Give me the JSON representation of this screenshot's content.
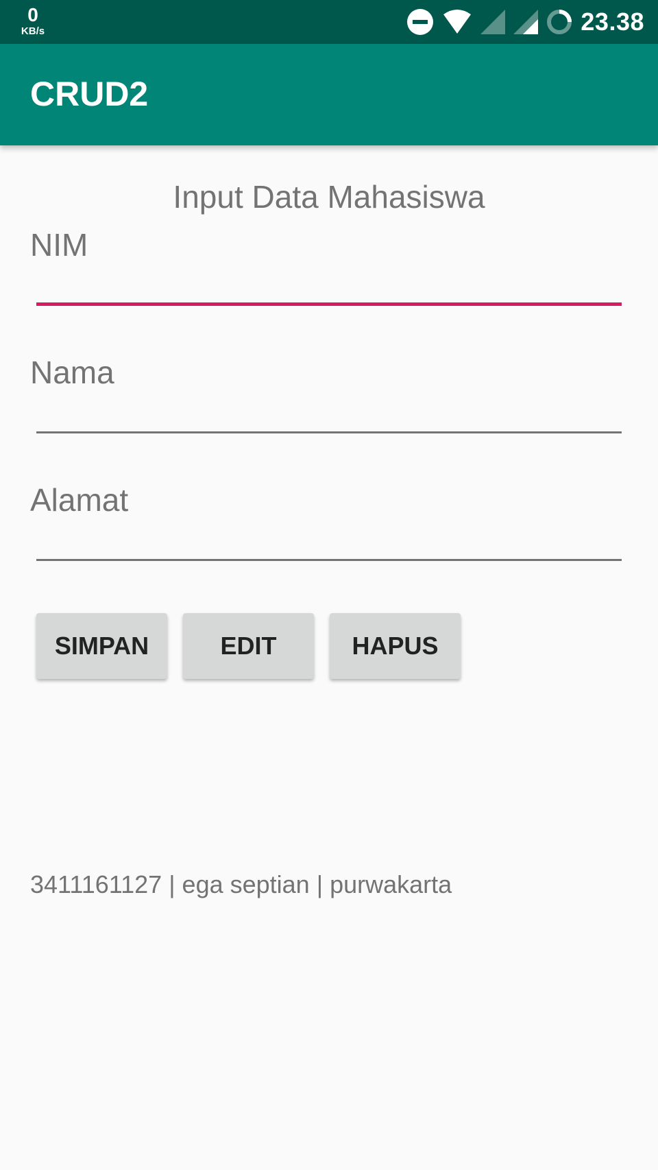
{
  "status_bar": {
    "net_speed_value": "0",
    "net_speed_unit": "KB/s",
    "time": "23.38",
    "icons": [
      "dnd-icon",
      "wifi-icon",
      "signal-icon",
      "signal-icon",
      "loading-icon"
    ]
  },
  "app_bar": {
    "title": "CRUD2"
  },
  "form": {
    "heading": "Input Data Mahasiswa",
    "nim_label": "NIM",
    "nim_value": "",
    "nama_label": "Nama",
    "nama_value": "",
    "alamat_label": "Alamat",
    "alamat_value": ""
  },
  "buttons": {
    "simpan": "SIMPAN",
    "edit": "EDIT",
    "hapus": "HAPUS"
  },
  "result": {
    "text": "3411161127 | ega septian | purwakarta"
  },
  "colors": {
    "status_bar": "#00574b",
    "app_bar": "#008577",
    "accent": "#d81b60",
    "background": "#fafafa",
    "button": "#d6d7d7"
  }
}
